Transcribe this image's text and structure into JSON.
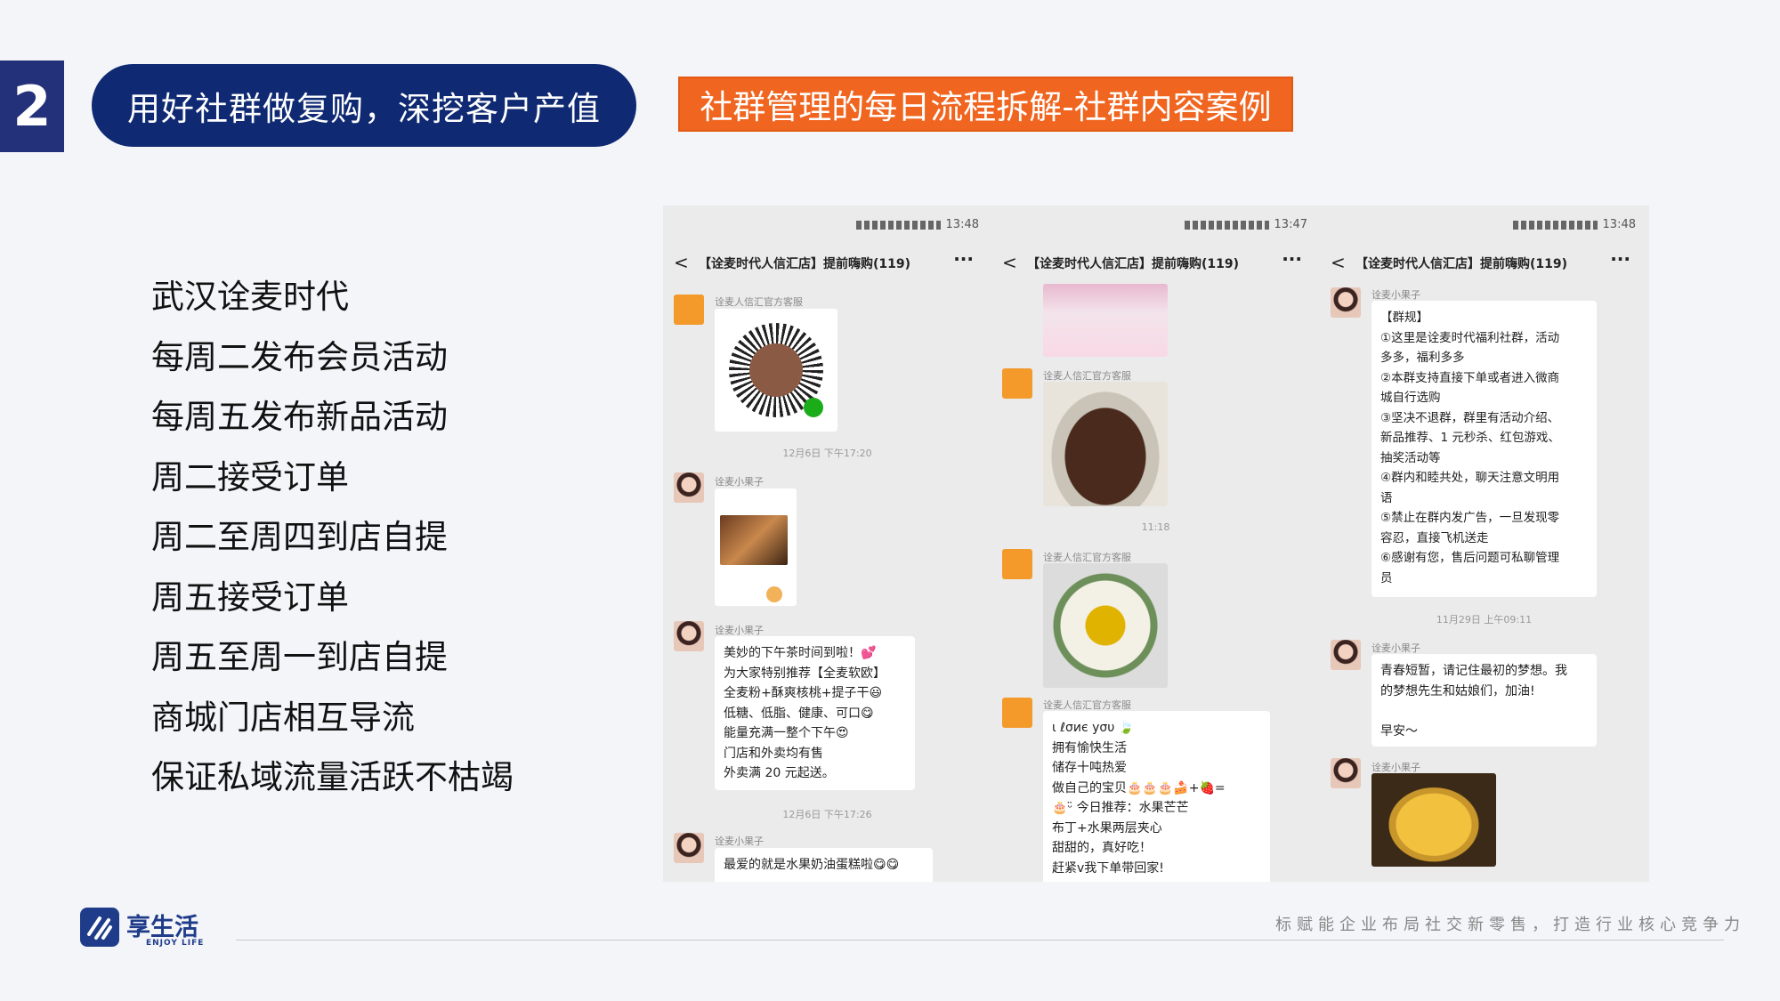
{
  "slide_number": "2",
  "title": "用好社群做复购，深挖客户产值",
  "banner": "社群管理的每日流程拆解-社群内容案例",
  "bullets": [
    "武汉诠麦时代",
    "每周二发布会员活动",
    "每周五发布新品活动",
    "周二接受订单",
    "周二至周四到店自提",
    "周五接受订单",
    "周五至周一到店自提",
    "商城门店相互导流",
    "保证私域流量活跃不枯竭"
  ],
  "phones": [
    {
      "time": "13:48",
      "chat_title": "【诠麦时代人信汇店】提前嗨购(119)",
      "back": "<",
      "more": "···",
      "messages": [
        {
          "sender": "诠麦人信汇官方客服"
        },
        {
          "timestamp": "12月6日 下午17:20"
        },
        {
          "sender": "诠麦小果子"
        },
        {
          "sender": "诠麦小果子",
          "text": "美妙的下午茶时间到啦！💕\n为大家特别推荐【全麦软欧】\n全麦粉+酥爽核桃+提子干😃\n低糖、低脂、健康、可口😋\n能量充满一整个下午😍\n门店和外卖均有售\n外卖满 20 元起送。"
        },
        {
          "timestamp": "12月6日 下午17:26"
        },
        {
          "sender": "诠麦小果子",
          "text": "最爱的就是水果奶油蛋糕啦😋😋"
        }
      ]
    },
    {
      "time": "13:47",
      "chat_title": "【诠麦时代人信汇店】提前嗨购(119)",
      "back": "<",
      "more": "···",
      "messages": [
        {
          "sender": "诠麦人信汇官方客服"
        },
        {
          "timestamp": "11:18"
        },
        {
          "sender": "诠麦人信汇官方客服"
        },
        {
          "sender": "诠麦人信汇官方客服",
          "text": "ι ℓσиє уσυ 🍃\n拥有愉快生活\n  储存十吨热爱\n做自己的宝贝🎂🎂🎂🍰+🍓=\n🎂ᵕ̈ 今日推荐：水果芒芒\n布丁+水果两层夹心\n甜甜的，真好吃！\n赶紧v我下单带回家!"
        }
      ]
    },
    {
      "time": "13:48",
      "chat_title": "【诠麦时代人信汇店】提前嗨购(119)",
      "back": "<",
      "more": "···",
      "messages": [
        {
          "sender": "诠麦小果子",
          "text": "【群规】\n①这里是诠麦时代福利社群，活动\n多多，福利多多\n②本群支持直接下单或者进入微商\n城自行选购\n③坚决不退群，群里有活动介绍、\n新品推荐、1 元秒杀、红包游戏、\n抽奖活动等\n④群内和睦共处，聊天注意文明用\n语\n⑤禁止在群内发广告，一旦发现零\n容忍，直接飞机送走\n⑥感谢有您，售后问题可私聊管理\n员"
        },
        {
          "timestamp": "11月29日 上午09:11"
        },
        {
          "sender": "诠麦小果子",
          "text": "青春短暂，请记住最初的梦想。我\n的梦想先生和姑娘们，加油!\n\n早安～"
        },
        {
          "sender": "诠麦小果子"
        }
      ]
    }
  ],
  "footer": {
    "logo_text": "享生活",
    "logo_sub": "ENJOY LIFE",
    "slogan": "标赋能企业布局社交新零售，打造行业核心竞争力"
  },
  "colors": {
    "navy": "#0f2a73",
    "orange": "#f0651f",
    "slide_num_bg": "#23307a"
  }
}
